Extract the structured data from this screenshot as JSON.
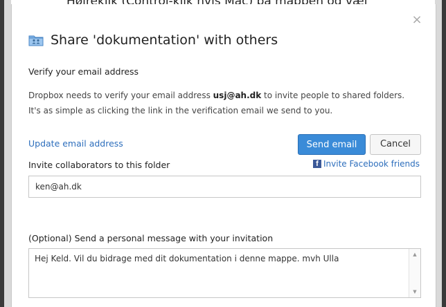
{
  "background": {
    "cut_off_text": "Højreklik (Control-klik hvis Mac) på mappen og væl"
  },
  "dialog": {
    "close_symbol": "×",
    "title": "Share 'dokumentation' with others",
    "icon": "shared-folder-icon"
  },
  "verify": {
    "heading": "Verify your email address",
    "body_before": "Dropbox needs to verify your email address ",
    "email": "usj@ah.dk",
    "body_after": " to invite people to shared folders. It's as simple as clicking the link in the verification email we send to you."
  },
  "actions": {
    "update_link": "Update email address",
    "send_label": "Send email",
    "cancel_label": "Cancel"
  },
  "invite": {
    "label": "Invite collaborators to this folder",
    "facebook_label": "Invite Facebook friends",
    "facebook_icon": "facebook-icon",
    "email_value": "ken@ah.dk"
  },
  "message": {
    "label": "(Optional) Send a personal message with your invitation",
    "value": "Hej Keld. Vil du bidrage med dit dokumentation i denne mappe. mvh Ulla"
  },
  "colors": {
    "primary_button": "#3a8bd8",
    "link": "#2d6ebc",
    "facebook": "#3b5998"
  }
}
